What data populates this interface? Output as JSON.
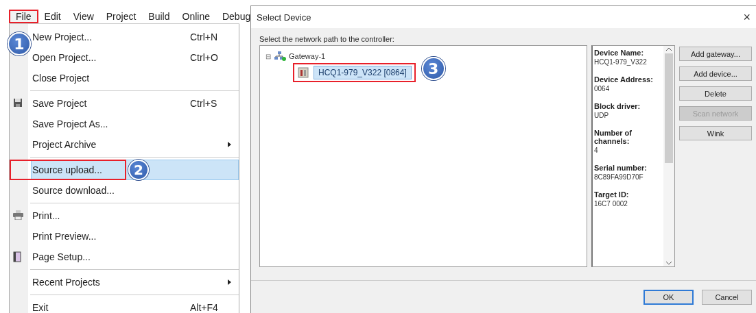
{
  "menu_bar": {
    "items": [
      {
        "label": "File",
        "selected": true,
        "annotated": true,
        "callout": "1"
      },
      {
        "label": "Edit",
        "selected": false
      },
      {
        "label": "View",
        "selected": false
      },
      {
        "label": "Project",
        "selected": false
      },
      {
        "label": "Build",
        "selected": false
      },
      {
        "label": "Online",
        "selected": false
      },
      {
        "label": "Debug",
        "selected": false
      }
    ]
  },
  "file_menu": {
    "items": [
      {
        "label": "New Project...",
        "shortcut": "Ctrl+N",
        "selected": false
      },
      {
        "label": "Open Project...",
        "shortcut": "Ctrl+O",
        "selected": false
      },
      {
        "label": "Close Project",
        "selected": false,
        "separator_after": true
      },
      {
        "label": "Save Project",
        "shortcut": "Ctrl+S",
        "selected": false
      },
      {
        "label": "Save Project As...",
        "selected": false
      },
      {
        "label": "Project Archive",
        "submenu": true,
        "selected": false,
        "separator_after": true
      },
      {
        "label": "Source upload...",
        "selected": true,
        "annotated": true,
        "callout": "2"
      },
      {
        "label": "Source download...",
        "selected": false,
        "separator_after": true
      },
      {
        "label": "Print...",
        "selected": false
      },
      {
        "label": "Print Preview...",
        "selected": false
      },
      {
        "label": "Page Setup...",
        "selected": false,
        "separator_after": true
      },
      {
        "label": "Recent Projects",
        "submenu": true,
        "selected": false,
        "separator_after": true
      },
      {
        "label": "Exit",
        "shortcut": "Alt+F4",
        "selected": false
      }
    ]
  },
  "dialog": {
    "title": "Select Device",
    "close": "×",
    "prompt": "Select the network path to the controller:",
    "tree": [
      {
        "label": "Gateway-1",
        "expanded": true,
        "toggle": "⊟",
        "selected": false,
        "children": [
          {
            "label": "HCQ1-979_V322 [0864]",
            "selected": true,
            "annotated": true,
            "callout": "3"
          }
        ]
      }
    ],
    "info": [
      {
        "label": "Device Name:",
        "value": "HCQ1-979_V322"
      },
      {
        "label": "Device Address:",
        "value": "0064"
      },
      {
        "label": "Block driver:",
        "value": "UDP"
      },
      {
        "label": "Number of channels:",
        "value": "4"
      },
      {
        "label": "Serial number:",
        "value": "8C89FA99D70F"
      },
      {
        "label": "Target ID:",
        "value": "16C7 0002"
      }
    ],
    "side_buttons": [
      {
        "label": "Add gateway...",
        "disabled": false
      },
      {
        "label": "Add device...",
        "disabled": false
      },
      {
        "label": "Delete",
        "disabled": false
      },
      {
        "label": "Scan network",
        "disabled": true
      },
      {
        "label": "Wink",
        "disabled": false
      }
    ],
    "footer_buttons": [
      {
        "label": "OK",
        "default": true
      },
      {
        "label": "Cancel",
        "default": false
      }
    ]
  }
}
